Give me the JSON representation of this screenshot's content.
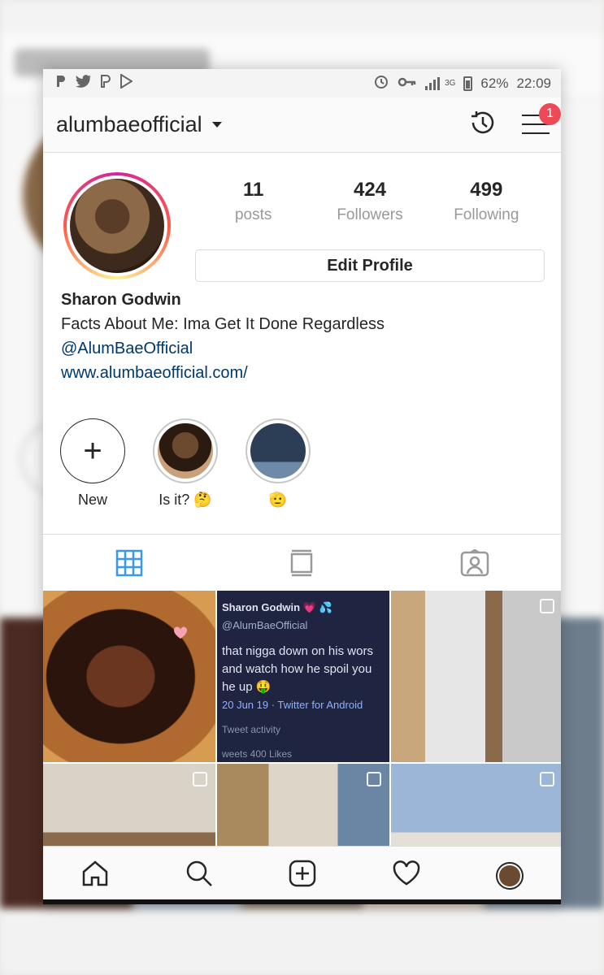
{
  "status_bar": {
    "battery": "62%",
    "time": "22:09",
    "network": "3G",
    "left_icons": [
      "pinterest-icon",
      "twitter-icon",
      "pinterest-p-icon",
      "play-store-icon"
    ],
    "right_icons": [
      "alarm-icon",
      "key-icon",
      "signal-icon",
      "battery-icon"
    ]
  },
  "header": {
    "username": "alumbaeofficial",
    "notification_count": "1"
  },
  "profile": {
    "stats": [
      {
        "value": "11",
        "label": "posts"
      },
      {
        "value": "424",
        "label": "Followers"
      },
      {
        "value": "499",
        "label": "Following"
      }
    ],
    "edit_label": "Edit Profile"
  },
  "bio": {
    "name": "Sharon Godwin",
    "text": "Facts About Me: Ima Get It Done Regardless",
    "handle": "@AlumBaeOfficial",
    "website": "www.alumbaeofficial.com/"
  },
  "stories": [
    {
      "label": "New"
    },
    {
      "label": "Is it? 🤔"
    },
    {
      "label": "🫡"
    }
  ],
  "posts": {
    "tweet": {
      "author": "Sharon Godwin 💗 💦",
      "handle": "@AlumBaeOfficial",
      "text": "that nigga down on his wors and watch how he spoil you he up 🤑",
      "meta": "20 Jun 19 · Twitter for Android",
      "activity": "Tweet activity",
      "likes": "weets  400 Likes"
    }
  },
  "colors": {
    "accent": "#3897f0",
    "badge": "#ed4956",
    "link": "#00376b"
  }
}
